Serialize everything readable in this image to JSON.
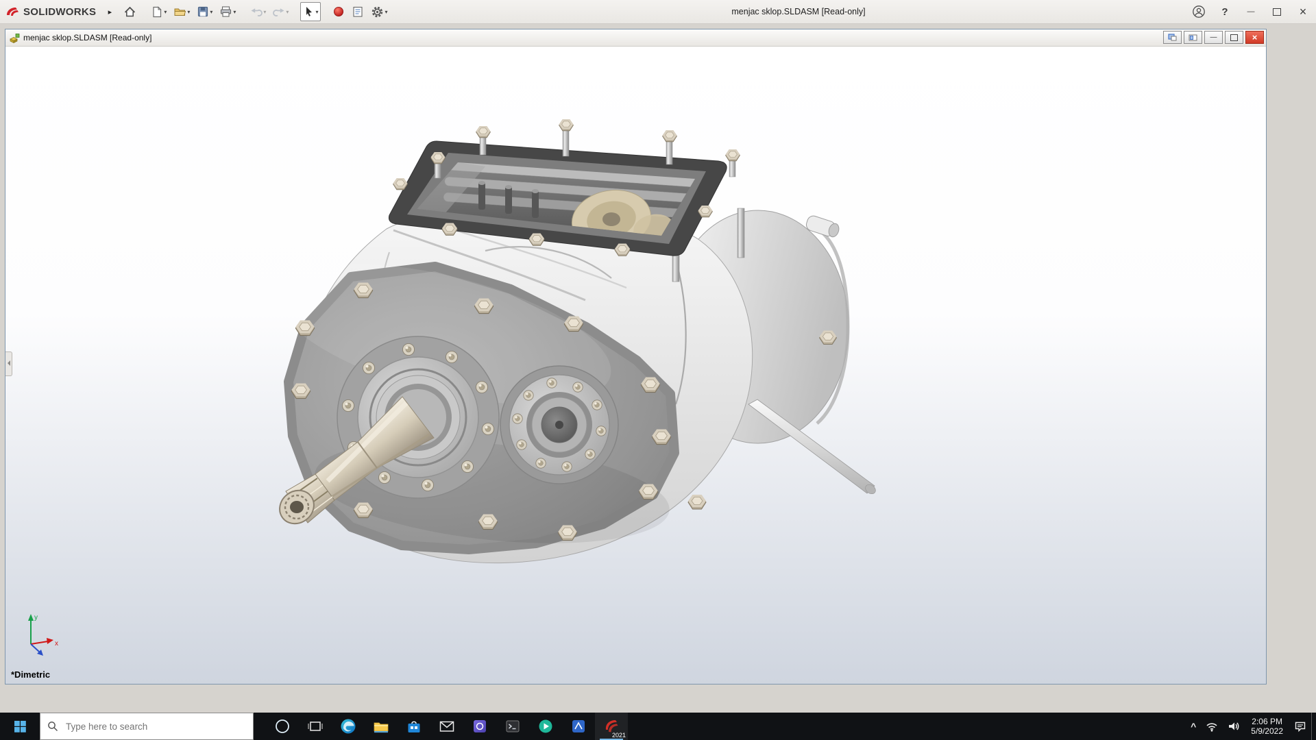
{
  "icons": {
    "dropdown_caret": "▾",
    "flyout_arrow": "▸",
    "close": "×",
    "minimize": "—",
    "help": "?",
    "tray_expand": "^"
  },
  "titlebar": {
    "brand": "SOLIDWORKS",
    "title": "menjac sklop.SLDASM [Read-only]"
  },
  "document_window": {
    "title": "menjac sklop.SLDASM [Read-only]",
    "view_label": "*Dimetric",
    "triad": {
      "x_label": "x",
      "y_label": "y"
    }
  },
  "taskbar": {
    "search_placeholder": "Type here to search",
    "solidworks_badge": "2021",
    "clock": {
      "time": "2:06 PM",
      "date": "5/9/2022"
    }
  }
}
